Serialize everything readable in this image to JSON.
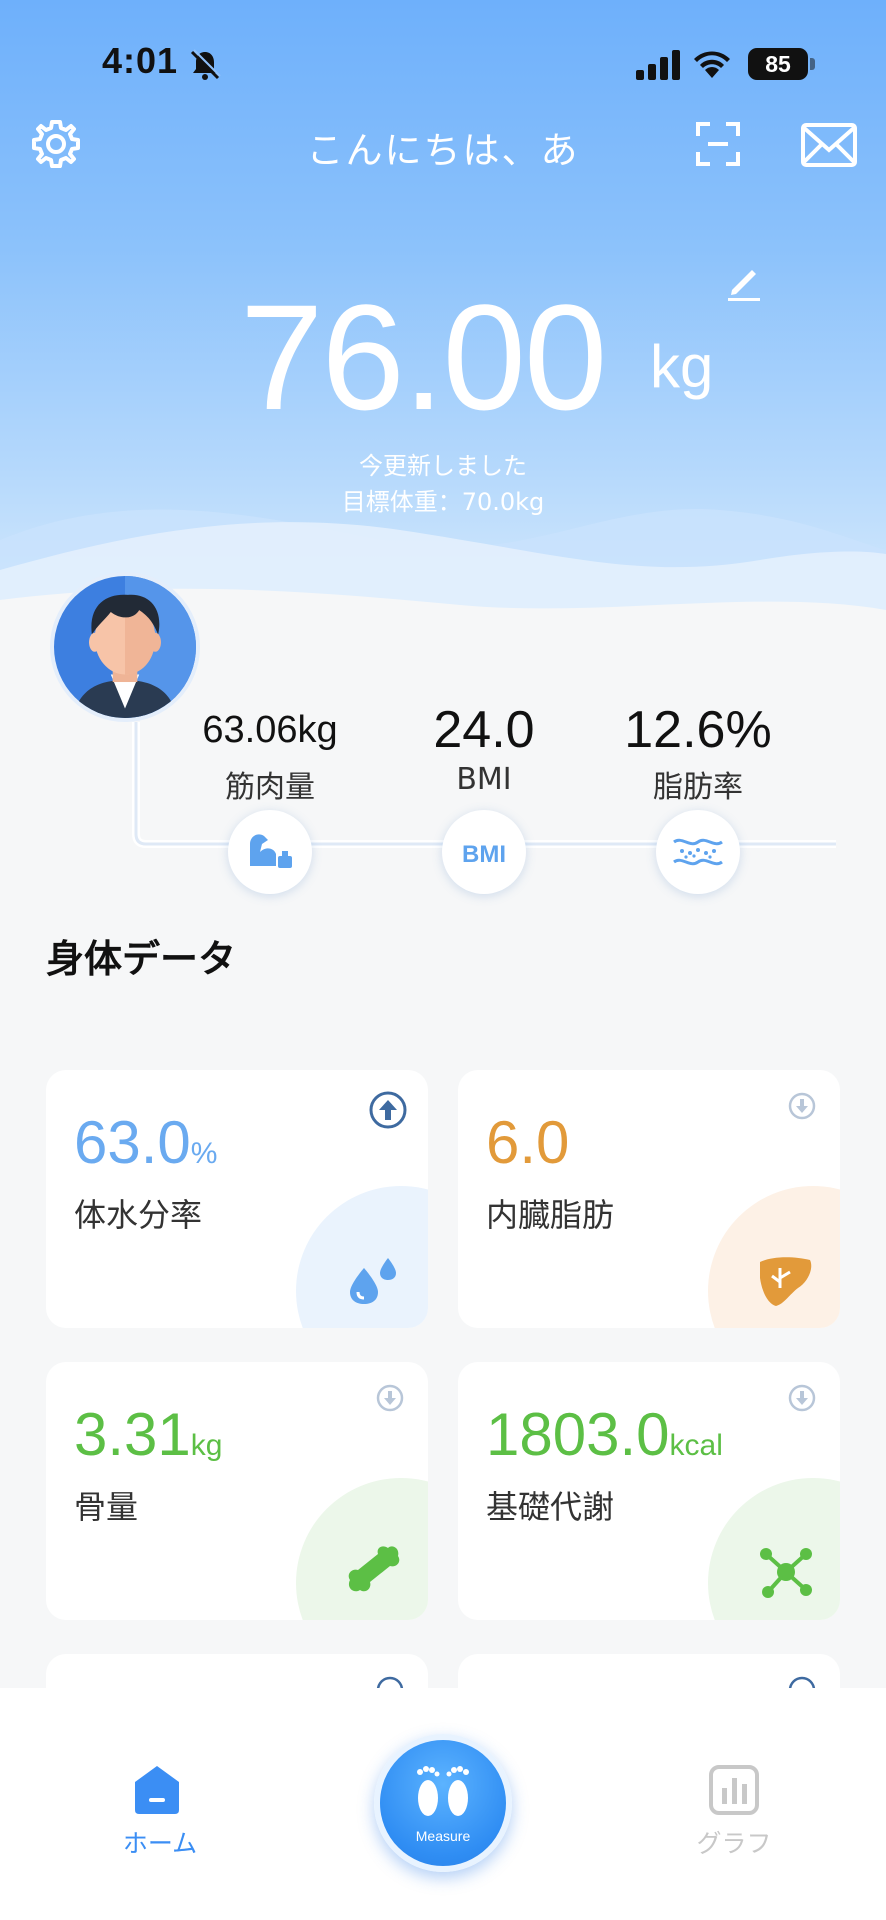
{
  "status_bar": {
    "time": "4:01",
    "battery": "85",
    "icons": [
      "bell-slash-icon",
      "signal-icon",
      "wifi-icon",
      "battery-icon"
    ]
  },
  "header": {
    "greeting": "こんにちは、あ",
    "icons": [
      "gear-icon",
      "scan-icon",
      "mail-icon"
    ]
  },
  "weight": {
    "value": "76.00",
    "unit": "kg",
    "updated": "今更新しました",
    "target": "目標体重：70.0kg"
  },
  "metrics": [
    {
      "value": "63.06kg",
      "label": "筋肉量",
      "icon": "muscle-icon"
    },
    {
      "value": "24.0",
      "label": "BMI",
      "icon": "bmi-icon"
    },
    {
      "value": "12.6%",
      "label": "脂肪率",
      "icon": "fat-icon"
    }
  ],
  "bmi_badge": "BMI",
  "section": {
    "title": "身体データ"
  },
  "cards": [
    {
      "value": "63.0",
      "unit": "%",
      "label": "体水分率",
      "color": "#6aaaf0",
      "trend": "up"
    },
    {
      "value": "6.0",
      "unit": "",
      "label": "内臓脂肪",
      "color": "#e29a3a",
      "trend": "down"
    },
    {
      "value": "3.31",
      "unit": "kg",
      "label": "骨量",
      "color": "#5cbf45",
      "trend": "down"
    },
    {
      "value": "1803.0",
      "unit": "kcal",
      "label": "基礎代謝",
      "color": "#5cbf45",
      "trend": "down"
    }
  ],
  "nav": {
    "home": "ホーム",
    "measure": "Measure",
    "graph": "グラフ",
    "accent": "#3b8ef4"
  }
}
